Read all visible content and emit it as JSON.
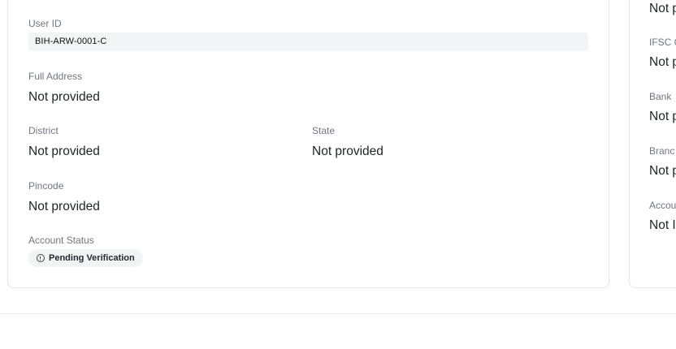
{
  "profile": {
    "user_id_label": "User ID",
    "user_id_value": "BIH-ARW-0001-C",
    "full_address_label": "Full Address",
    "full_address_value": "Not provided",
    "district_label": "District",
    "district_value": "Not provided",
    "state_label": "State",
    "state_value": "Not provided",
    "pincode_label": "Pincode",
    "pincode_value": "Not provided",
    "account_status_label": "Account Status",
    "account_status_value": "Pending Verification"
  },
  "bank": {
    "top_value": "Not p",
    "ifsc_label": "IFSC C",
    "ifsc_value": "Not p",
    "bank_label": "Bank",
    "bank_value": "Not p",
    "branch_label": "Branc",
    "branch_value": "Not p",
    "account_label": "Accou",
    "account_value": "Not I"
  }
}
